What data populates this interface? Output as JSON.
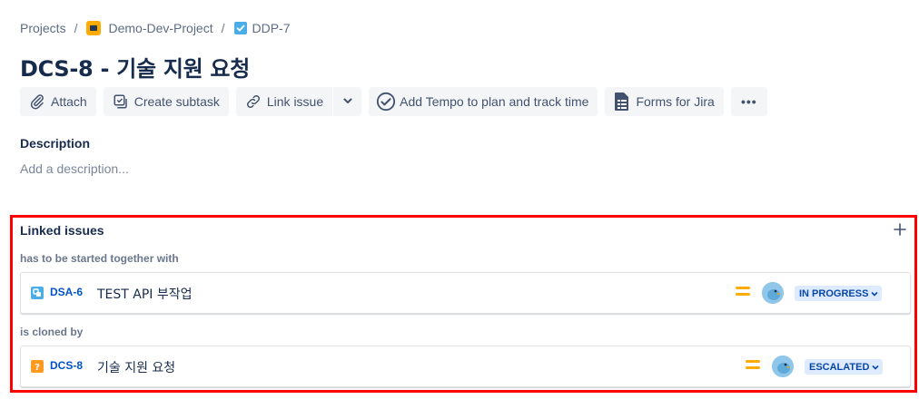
{
  "breadcrumb": {
    "projects": "Projects",
    "separator": "/",
    "project": "Demo-Dev-Project",
    "parent": "DDP-7"
  },
  "issue": {
    "title": "DCS-8 - 기술 지원 요청"
  },
  "toolbar": {
    "attach": "Attach",
    "create_subtask": "Create subtask",
    "link_issue": "Link issue",
    "tempo": "Add Tempo to plan and track time",
    "forms": "Forms for Jira",
    "more": "•••"
  },
  "description": {
    "label": "Description",
    "placeholder": "Add a description..."
  },
  "linked_issues": {
    "title": "Linked issues",
    "groups": [
      {
        "relation": "has to be started together with",
        "issue": {
          "key": "DSA-6",
          "summary": "TEST API 부작업",
          "type_icon": "subtask-icon",
          "type_color": "#4bade8",
          "priority": "medium-priority-icon",
          "status": "IN PROGRESS"
        }
      },
      {
        "relation": "is cloned by",
        "issue": {
          "key": "DCS-8",
          "summary": "기술 지원 요청",
          "type_icon": "question-icon",
          "type_color": "#ff991f",
          "priority": "medium-priority-icon",
          "status": "ESCALATED"
        }
      }
    ]
  },
  "colors": {
    "highlight_border": "#ff0000",
    "link_blue": "#0052cc",
    "status_bg": "#deebff",
    "priority_medium": "#ffab00"
  }
}
